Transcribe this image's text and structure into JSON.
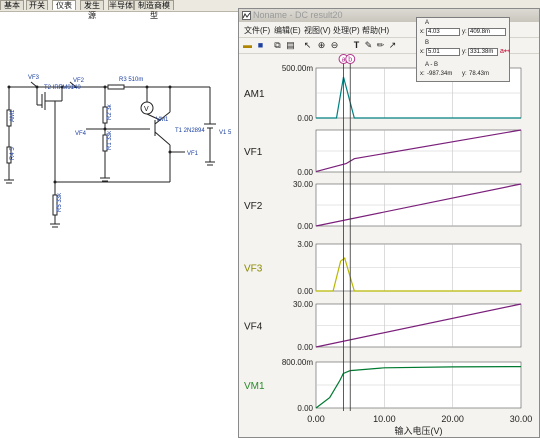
{
  "tabs": [
    "基本",
    "开关",
    "仪表",
    "发生源",
    "半导体",
    "制造商模型"
  ],
  "schematic": {
    "vf3": "VF3",
    "vf2": "VF2",
    "vf4": "VF4",
    "vf1": "VF1",
    "t2": "T2 IRFM9140",
    "r3": "R3 510m",
    "r2": "R2 3k",
    "r1": "R1 33k",
    "am1": "AM1",
    "r4": "R4 5",
    "r5": "R5 33k",
    "vm1": "VM1",
    "v_symbol": "V",
    "t1": "T1 2N2894",
    "v1": "V1 5"
  },
  "window": {
    "title": "Noname - DC result20",
    "menu": [
      "文件(F)",
      "编辑(E)",
      "视图(V)",
      "处理(P)",
      "帮助(H)"
    ]
  },
  "cursor_panel": {
    "a_label": "A",
    "a_x_label": "x:",
    "a_x": "4.03",
    "a_y_label": "y:",
    "a_y": "409.8m",
    "b_label": "B",
    "b_x_label": "x:",
    "b_x": "5.01",
    "b_y_label": "y:",
    "b_y": "331.38m",
    "diff_label": "A - B",
    "d_x_label": "x:",
    "d_x": "-987.34m",
    "d_y_label": "y:",
    "d_y": "78.43m",
    "a_marker": "a",
    "b_marker": "b"
  },
  "colors": {
    "am1": "#008080",
    "vf_line": "#7a1f7a",
    "vf3": "#b8b800",
    "vm1": "#007a30",
    "label_green": "#2b8a2b",
    "label_olive": "#8a8a00"
  },
  "chart_data": [
    {
      "type": "line",
      "title": "AM1",
      "ylim": [
        0,
        500
      ],
      "ytick_labels": [
        "0.00",
        "500.00m"
      ],
      "x": [
        0,
        3,
        4.03,
        5.6,
        30
      ],
      "series": [
        {
          "values": [
            0,
            0,
            409.8,
            0,
            0
          ]
        }
      ]
    },
    {
      "type": "line",
      "title": "VF1",
      "ylim": [
        0,
        30
      ],
      "ytick_labels": [
        "0.00"
      ],
      "x": [
        0,
        4.4,
        5.6,
        30
      ],
      "series": [
        {
          "values": [
            0.3,
            6,
            9.5,
            30
          ]
        }
      ]
    },
    {
      "type": "line",
      "title": "VF2",
      "ylim": [
        0,
        30
      ],
      "ytick_labels": [
        "0.00",
        "30.00"
      ],
      "x": [
        0,
        30
      ],
      "series": [
        {
          "values": [
            0,
            30
          ]
        }
      ]
    },
    {
      "type": "line",
      "title": "VF3",
      "ylim": [
        0,
        3
      ],
      "ytick_labels": [
        "0.00",
        "3.00"
      ],
      "x": [
        0,
        2.5,
        3.6,
        4.2,
        5.6,
        30
      ],
      "series": [
        {
          "values": [
            0,
            0,
            1.9,
            2.1,
            0,
            0
          ]
        }
      ]
    },
    {
      "type": "line",
      "title": "VF4",
      "ylim": [
        0,
        30
      ],
      "ytick_labels": [
        "0.00",
        "30.00"
      ],
      "x": [
        0,
        30
      ],
      "series": [
        {
          "values": [
            0,
            30
          ]
        }
      ]
    },
    {
      "type": "line",
      "title": "VM1",
      "ylim": [
        0,
        800
      ],
      "ytick_labels": [
        "0.00",
        "800.00m"
      ],
      "x": [
        0,
        2,
        3.5,
        4,
        5,
        10,
        20,
        30
      ],
      "series": [
        {
          "values": [
            0,
            180,
            480,
            600,
            650,
            700,
            715,
            720
          ]
        }
      ]
    }
  ],
  "x_axis": {
    "ticks": [
      "0.00",
      "10.00",
      "20.00",
      "30.00"
    ],
    "label": "输入电压(V)",
    "range": [
      0,
      30
    ]
  }
}
